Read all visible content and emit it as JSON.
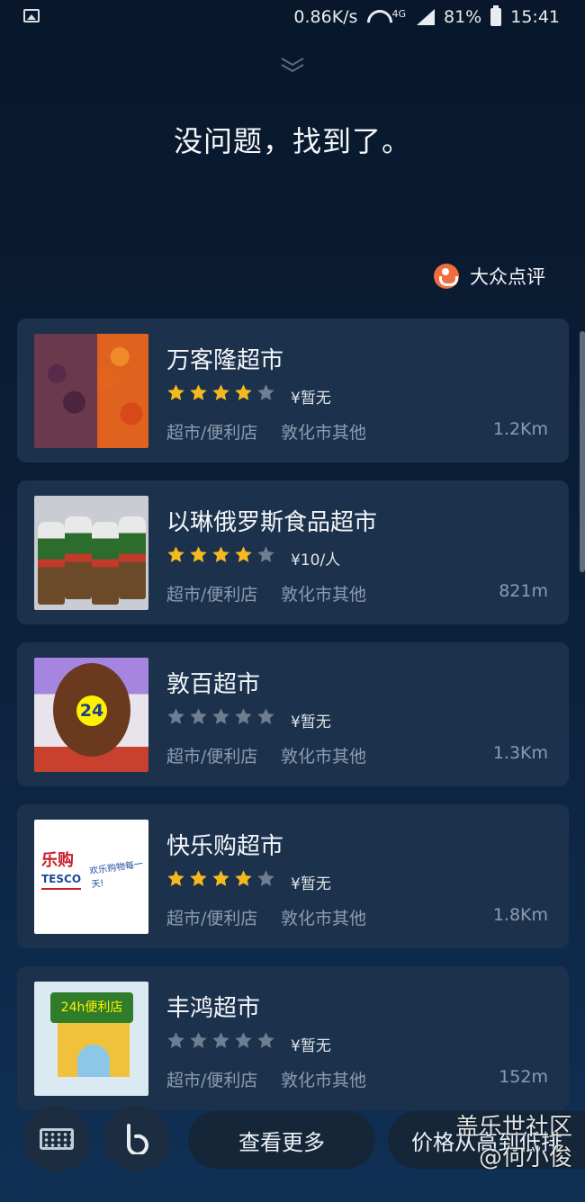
{
  "status_bar": {
    "speed": "0.86K/s",
    "network": "4G",
    "battery": "81%",
    "time": "15:41"
  },
  "headline": "没问题，找到了。",
  "source": {
    "name": "大众点评",
    "icon": "dianping-icon",
    "color": "#f26d3d"
  },
  "colors": {
    "star_on": "#f5b920",
    "star_off": "#6e7d90"
  },
  "results": [
    {
      "name": "万客隆超市",
      "rating": 4,
      "price": "¥暂无",
      "category": "超市/便利店",
      "area": "敦化市其他",
      "distance": "1.2Km"
    },
    {
      "name": "以琳俄罗斯食品超市",
      "rating": 4,
      "price": "¥10/人",
      "category": "超市/便利店",
      "area": "敦化市其他",
      "distance": "821m"
    },
    {
      "name": "敦百超市",
      "rating": 0,
      "price": "¥暂无",
      "category": "超市/便利店",
      "area": "敦化市其他",
      "distance": "1.3Km",
      "thumb_text": "24"
    },
    {
      "name": "快乐购超市",
      "rating": 4,
      "price": "¥暂无",
      "category": "超市/便利店",
      "area": "敦化市其他",
      "distance": "1.8Km",
      "thumb_text": "乐购",
      "thumb_sub": "TESCO",
      "thumb_slogan": "欢乐购物每一天!"
    },
    {
      "name": "丰鸿超市",
      "rating": 0,
      "price": "¥暂无",
      "category": "超市/便利店",
      "area": "敦化市其他",
      "distance": "152m",
      "thumb_text": "24h便利店"
    }
  ],
  "bottom": {
    "more_label": "查看更多",
    "sort_label": "价格从高到低排",
    "watermark_line1": "盖乐世社区",
    "watermark_line2": "@何小俊"
  }
}
